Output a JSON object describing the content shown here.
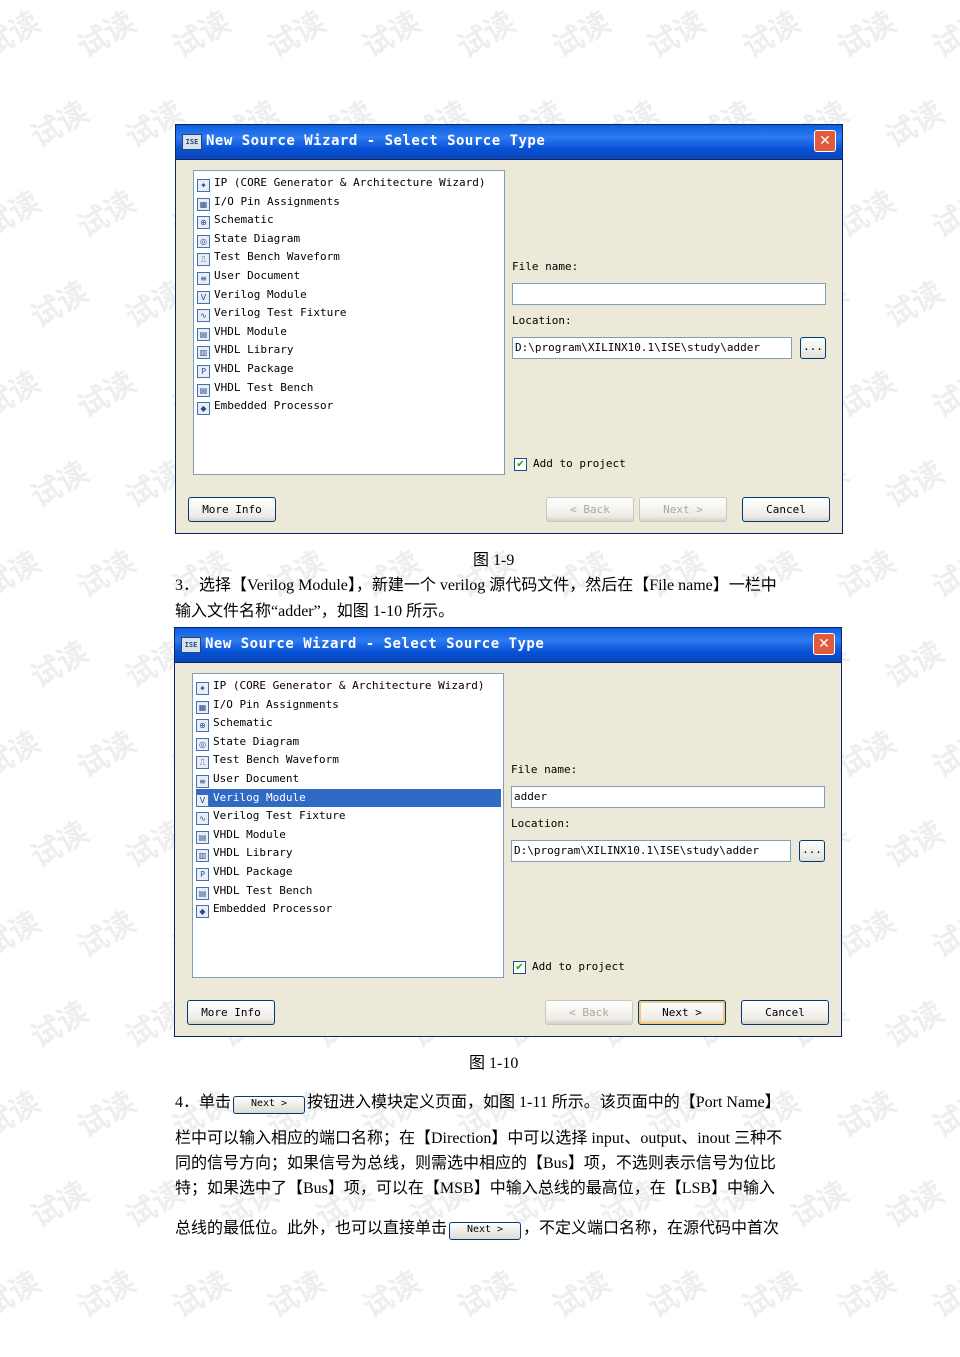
{
  "dialog": {
    "title": "New Source Wizard - Select Source Type",
    "close": "✕",
    "source_types": [
      {
        "label": "IP (CORE Generator & Architecture Wizard)",
        "icon": "ip-core-icon"
      },
      {
        "label": "I/O Pin Assignments",
        "icon": "io-pin-icon"
      },
      {
        "label": "Schematic",
        "icon": "schematic-icon"
      },
      {
        "label": "State Diagram",
        "icon": "state-diagram-icon"
      },
      {
        "label": "Test Bench Waveform",
        "icon": "waveform-icon"
      },
      {
        "label": "User Document",
        "icon": "document-icon"
      },
      {
        "label": "Verilog Module",
        "icon": "verilog-icon"
      },
      {
        "label": "Verilog Test Fixture",
        "icon": "test-fixture-icon"
      },
      {
        "label": "VHDL Module",
        "icon": "vhdl-module-icon"
      },
      {
        "label": "VHDL Library",
        "icon": "vhdl-library-icon"
      },
      {
        "label": "VHDL Package",
        "icon": "vhdl-package-icon"
      },
      {
        "label": "VHDL Test Bench",
        "icon": "vhdl-testbench-icon"
      },
      {
        "label": "Embedded Processor",
        "icon": "processor-icon"
      }
    ],
    "file_name_label": "File name:",
    "location_label": "Location:",
    "browse_label": "...",
    "add_to_project": "Add to project",
    "buttons": {
      "more_info": "More Info",
      "back": "< Back",
      "next": "Next >",
      "cancel": "Cancel"
    }
  },
  "figure1": {
    "file_name": "",
    "location": "D:\\program\\XILINX10.1\\ISE\\study\\adder",
    "caption": "图 1-9"
  },
  "figure2": {
    "file_name": "adder",
    "location": "D:\\program\\XILINX10.1\\ISE\\study\\adder",
    "selected": "Verilog Module",
    "caption": "图 1-10"
  },
  "text": {
    "step3_line1": "3．选择【Verilog Module】，新建一个 verilog 源代码文件，然后在【File name】一栏中",
    "step3_line2": "输入文件名称“adder”，如图 1-10 所示。",
    "step4_line1_a": "4．单击",
    "step4_line1_b": "按钮进入模块定义页面，如图 1-11 所示。该页面中的【Port Name】",
    "step4_line2": "栏中可以输入相应的端口名称；在【Direction】中可以选择 input、output、inout 三种不",
    "step4_line3": "同的信号方向；如果信号为总线，则需选中相应的【Bus】项，不选则表示信号为位比",
    "step4_line4": "特；如果选中了【Bus】项，可以在【MSB】中输入总线的最高位，在【LSB】中输入",
    "step4_line5_a": "总线的最低位。此外，也可以直接单击",
    "step4_line5_b": "，不定义端口名称，在源代码中首次",
    "inline_next": "Next >"
  },
  "watermark": "试读"
}
